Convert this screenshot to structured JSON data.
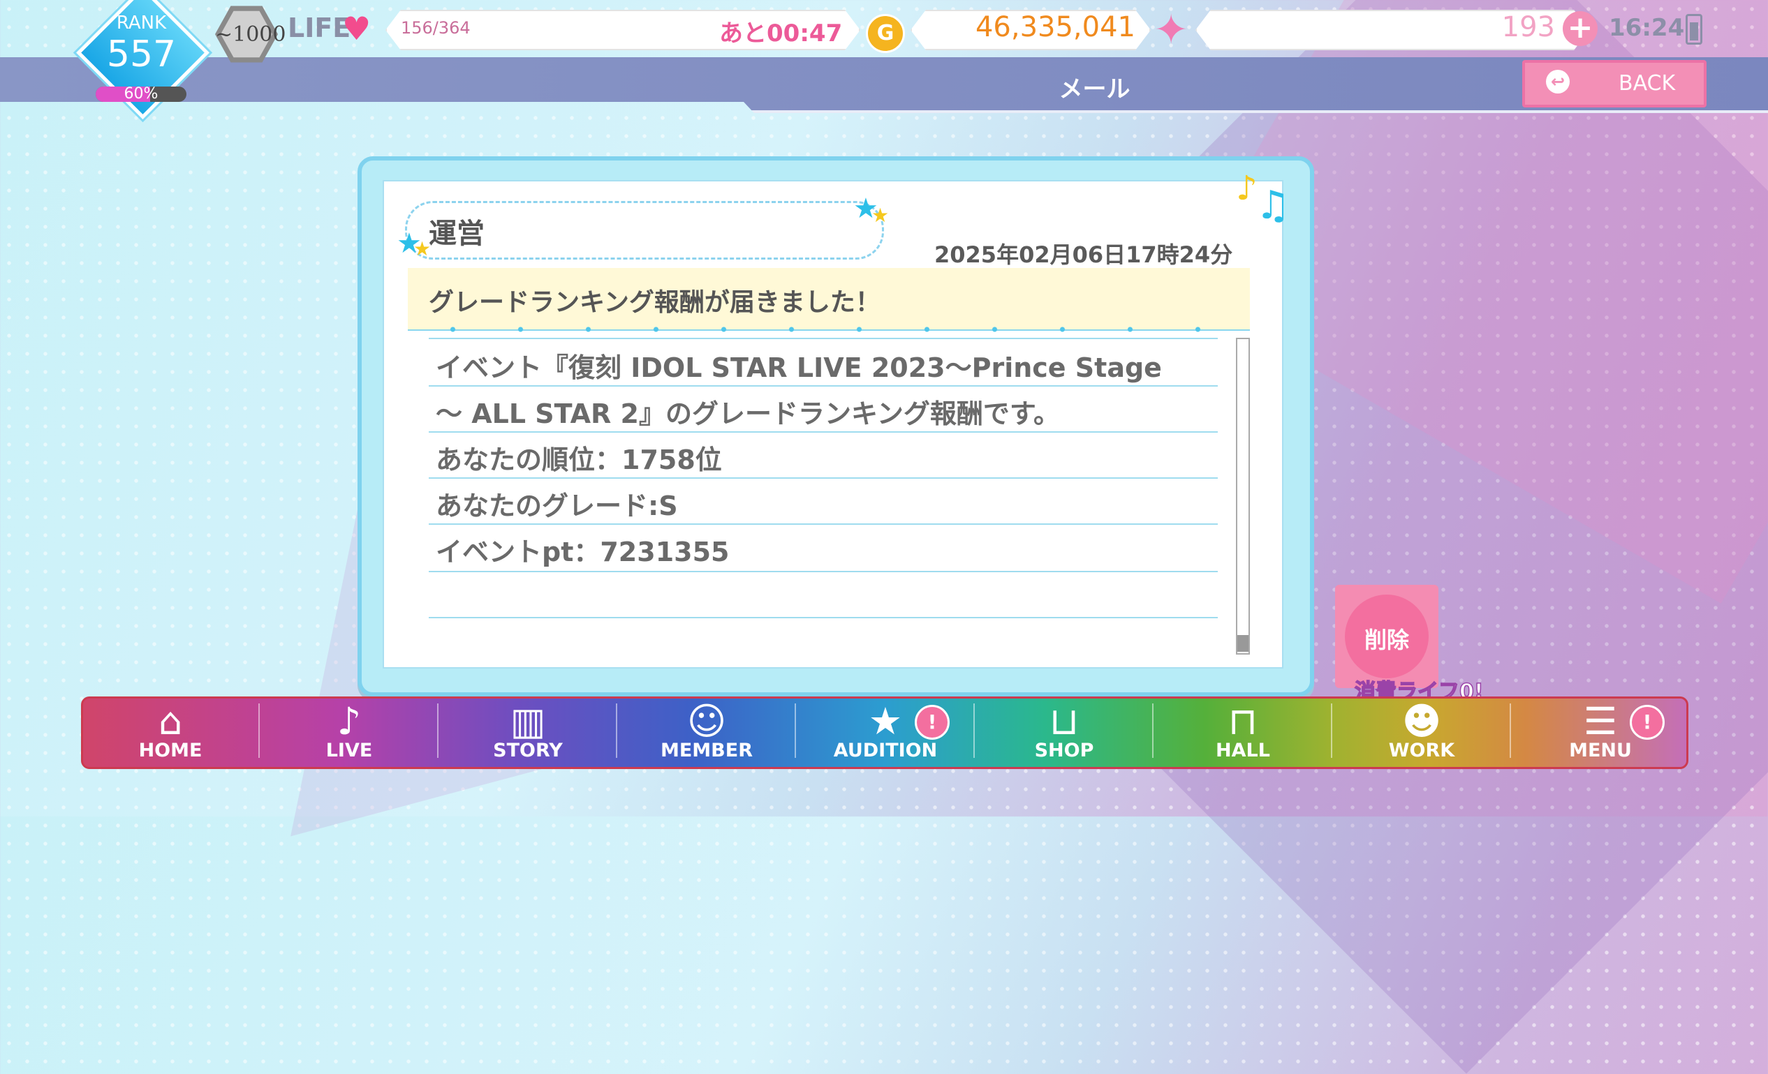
{
  "status": {
    "rank_label": "RANK",
    "rank_value": "557",
    "rank_progress_percent": 60,
    "rank_percent_text": "60%",
    "medal_text": "~1000",
    "life_label": "LIFE",
    "life_value": "156/364",
    "life_timer": "あと00:47",
    "gold_icon": "G",
    "gold_value": "46,335,041",
    "jewel_value": "193",
    "clock": "16:24"
  },
  "header": {
    "title": "メール",
    "back_label": "BACK"
  },
  "mail": {
    "sender": "運営",
    "date": "2025年02月06日17時24分",
    "subject": "グレードランキング報酬が届きました！",
    "body_lines": [
      "イベント『復刻 IDOL STAR LIVE 2023〜Prince Stage",
      "〜 ALL STAR 2』のグレードランキング報酬です。",
      "あなたの順位：1758位",
      "あなたのグレード:S",
      "イベントpt：7231355"
    ]
  },
  "delete": {
    "label": "削除",
    "cost_note": "消費ライフ0!"
  },
  "nav": {
    "items": [
      {
        "label": "HOME",
        "icon": "home-icon"
      },
      {
        "label": "LIVE",
        "icon": "music-note-icon"
      },
      {
        "label": "STORY",
        "icon": "book-icon"
      },
      {
        "label": "MEMBER",
        "icon": "member-icon"
      },
      {
        "label": "AUDITION",
        "icon": "audition-card-icon"
      },
      {
        "label": "SHOP",
        "icon": "basket-icon"
      },
      {
        "label": "HALL",
        "icon": "stage-icon"
      },
      {
        "label": "WORK",
        "icon": "work-icon"
      },
      {
        "label": "MENU",
        "icon": "menu-list-icon"
      }
    ],
    "badge_text": "!"
  },
  "colors": {
    "accent_pink": "#f38fb6",
    "rank_blue": "#1aa7e6",
    "gold": "#f08a1e",
    "card_border": "#7fd2ee"
  }
}
